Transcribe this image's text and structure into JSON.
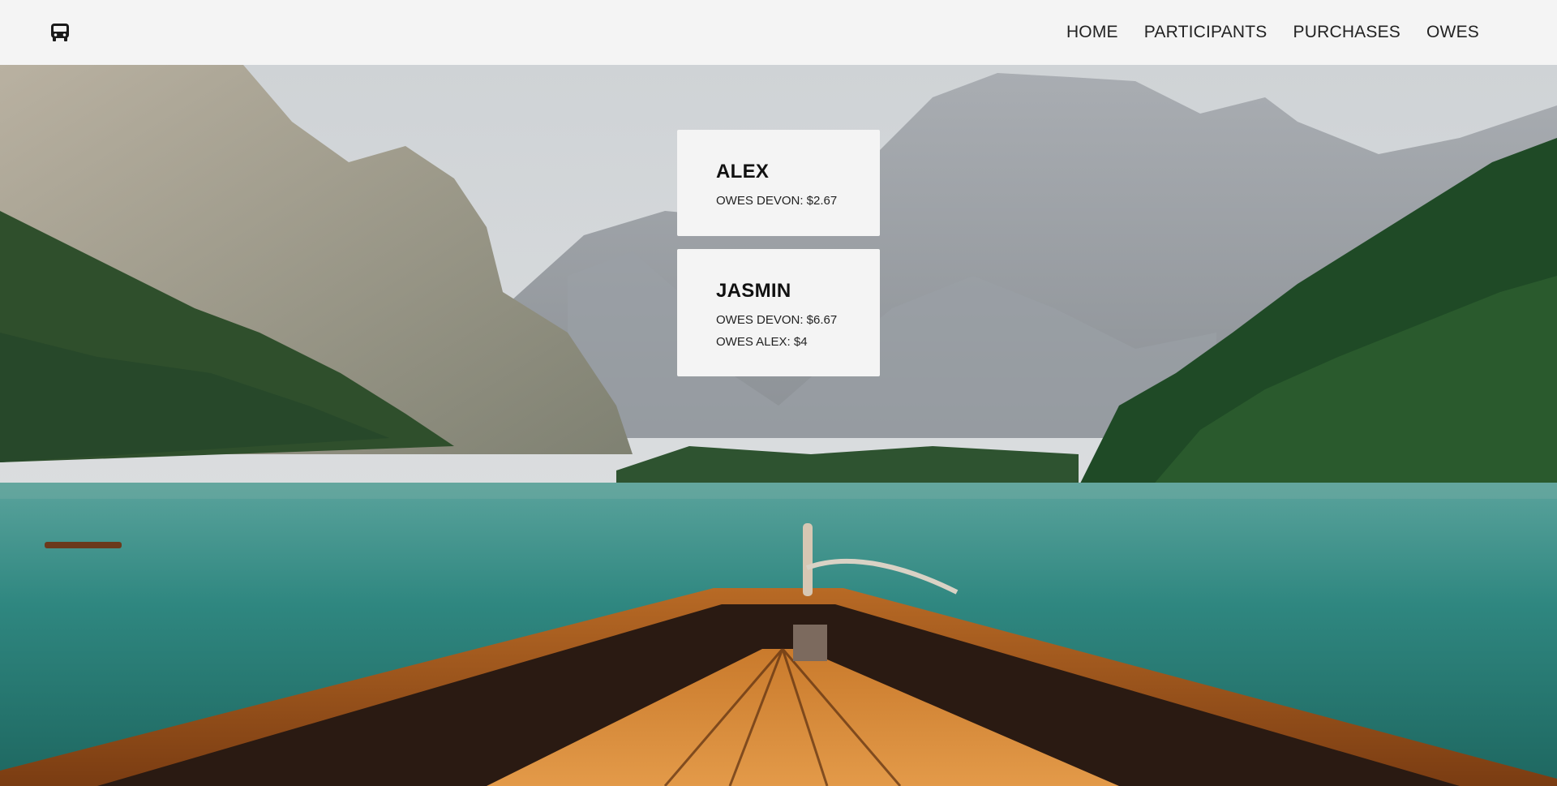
{
  "nav": {
    "logo_icon": "bus-icon",
    "links": [
      "HOME",
      "PARTICIPANTS",
      "PURCHASES",
      "OWES"
    ]
  },
  "cards": [
    {
      "name": "ALEX",
      "lines": [
        "OWES DEVON: $2.67"
      ]
    },
    {
      "name": "JASMIN",
      "lines": [
        "OWES DEVON: $6.67",
        "OWES ALEX: $4"
      ]
    }
  ]
}
